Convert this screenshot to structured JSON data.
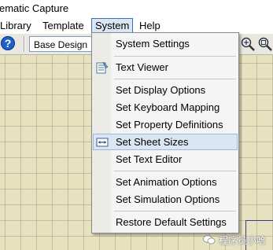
{
  "window": {
    "title": "ematic Capture"
  },
  "menubar": {
    "items": [
      {
        "label": "Library"
      },
      {
        "label": "Template"
      },
      {
        "label": "System"
      },
      {
        "label": "Help"
      }
    ]
  },
  "toolbar": {
    "design_select": "Base Design",
    "icons": [
      "help-icon",
      "zoom-in-icon",
      "zoom-area-icon"
    ]
  },
  "system_menu": {
    "items": [
      {
        "label": "System Settings",
        "icon": ""
      },
      {
        "label": "Text Viewer",
        "icon": "text-viewer-icon"
      },
      {
        "label": "Set Display Options",
        "icon": ""
      },
      {
        "label": "Set Keyboard Mapping",
        "icon": ""
      },
      {
        "label": "Set Property Definitions",
        "icon": ""
      },
      {
        "label": "Set Sheet Sizes",
        "icon": "sheet-size-icon"
      },
      {
        "label": "Set Text Editor",
        "icon": ""
      },
      {
        "label": "Set Animation Options",
        "icon": ""
      },
      {
        "label": "Set Simulation Options",
        "icon": ""
      },
      {
        "label": "Restore Default Settings",
        "icon": ""
      }
    ],
    "highlighted": "Set Sheet Sizes"
  },
  "watermark": {
    "text": "程序员小哈"
  },
  "colors": {
    "highlight": "#dbe6f5",
    "canvas": "#e6e2bf",
    "help_icon": "#1f5fc6"
  }
}
